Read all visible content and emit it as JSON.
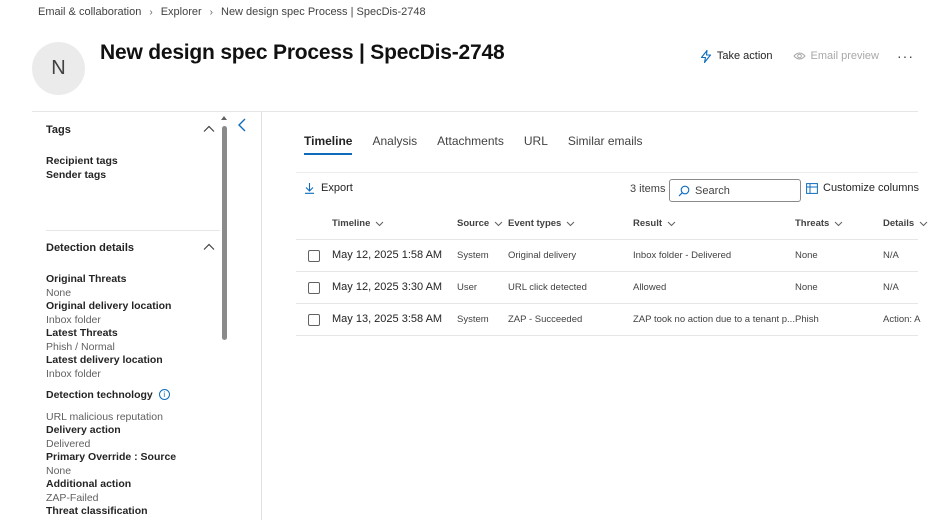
{
  "breadcrumb": [
    "Email & collaboration",
    "Explorer",
    "New design spec Process | SpecDis-2748"
  ],
  "header": {
    "avatar_initial": "N",
    "title": "New design spec Process | SpecDis-2748",
    "take_action": "Take action",
    "email_preview": "Email preview",
    "more": "···"
  },
  "left_panel": {
    "tags": {
      "title": "Tags",
      "recipient_tags": "Recipient tags",
      "sender_tags": "Sender tags"
    },
    "detection": {
      "title": "Detection details",
      "items": [
        {
          "label": "Original Threats",
          "value": "None"
        },
        {
          "label": "Original delivery location",
          "value": "Inbox folder"
        },
        {
          "label": "Latest Threats",
          "value": "Phish / Normal"
        },
        {
          "label": "Latest delivery location",
          "value": "Inbox folder"
        },
        {
          "label": "Detection technology",
          "value": "URL malicious reputation"
        },
        {
          "label": "Delivery action",
          "value": "Delivered"
        },
        {
          "label": "Primary Override : Source",
          "value": "None"
        },
        {
          "label": "Additional action",
          "value": "ZAP-Failed"
        },
        {
          "label": "Threat classification",
          "value": ""
        }
      ]
    }
  },
  "tabs": [
    "Timeline",
    "Analysis",
    "Attachments",
    "URL",
    "Similar emails"
  ],
  "active_tab": "Timeline",
  "toolbar": {
    "export": "Export",
    "item_count": "3 items",
    "search_placeholder": "Search",
    "customize_columns": "Customize columns"
  },
  "table": {
    "columns": [
      "Timeline",
      "Source",
      "Event types",
      "Result",
      "Threats",
      "Details"
    ],
    "rows": [
      {
        "timeline": "May 12, 2025 1:58 AM",
        "source": "System",
        "event_type": "Original delivery",
        "result": "Inbox folder - Delivered",
        "threats": "None",
        "details": "N/A"
      },
      {
        "timeline": "May 12, 2025 3:30 AM",
        "source": "User",
        "event_type": "URL click detected",
        "result": "Allowed",
        "threats": "None",
        "details": "N/A"
      },
      {
        "timeline": "May 13, 2025 3:58 AM",
        "source": "System",
        "event_type": "ZAP - Succeeded",
        "result": "ZAP took no action due to a tenant p...",
        "threats": "Phish",
        "details": "Action: A"
      }
    ]
  },
  "colors": {
    "accent": "#0f6cbd",
    "text_primary": "#242424",
    "text_secondary": "#616161",
    "divider": "#e6e6e6"
  }
}
